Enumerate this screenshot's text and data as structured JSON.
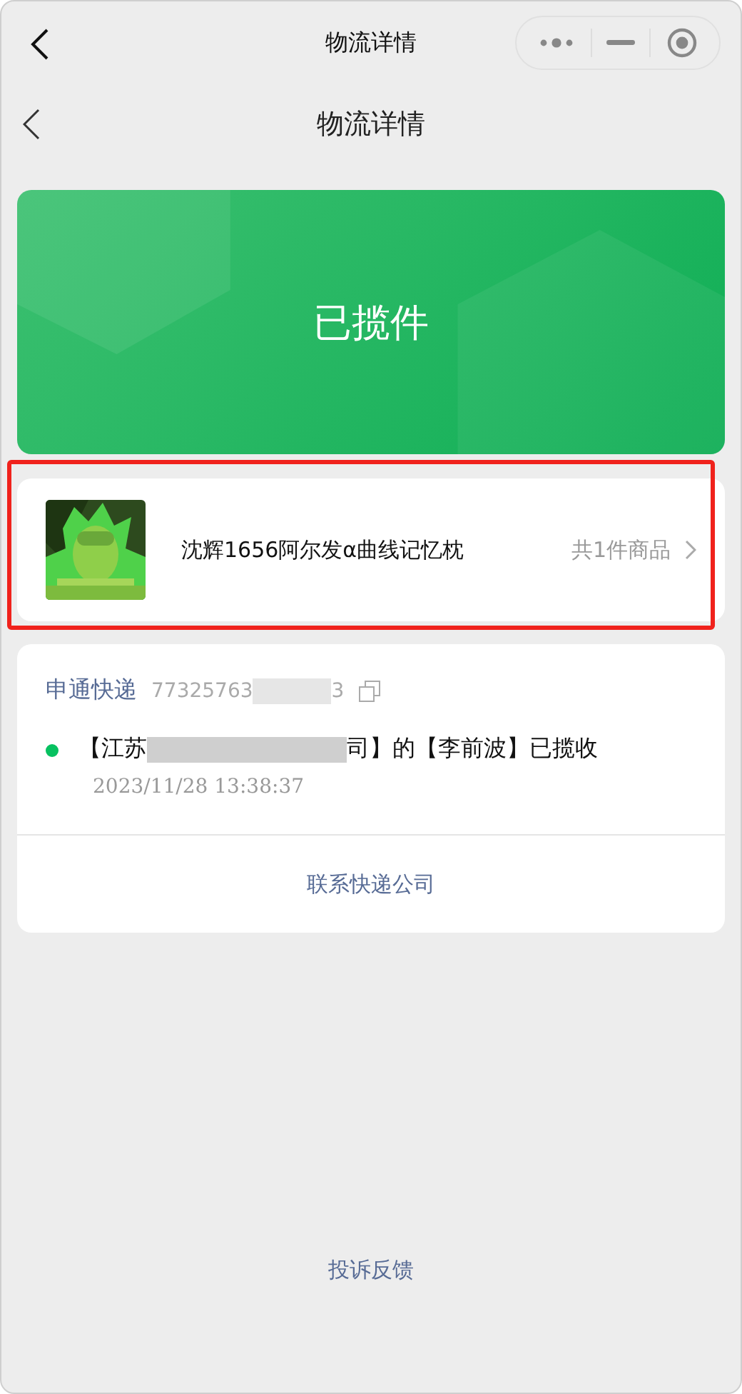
{
  "window": {
    "title": "物流详情"
  },
  "nav": {
    "title": "物流详情"
  },
  "banner": {
    "status": "已揽件"
  },
  "product": {
    "name": "沈辉1656阿尔发α曲线记忆枕",
    "count": "共1件商品",
    "highlighted": true
  },
  "shipment": {
    "carrier": "申通快递",
    "tracking_start": "77325763",
    "tracking_end": "3",
    "redacted": true
  },
  "events": [
    {
      "text_start": "【江苏",
      "text_end": "司】的【李前波】已揽收",
      "time": "2023/11/28 13:38:37",
      "selected": true
    }
  ],
  "contact_button": "联系快递公司",
  "feedback_link": "投诉反馈"
}
